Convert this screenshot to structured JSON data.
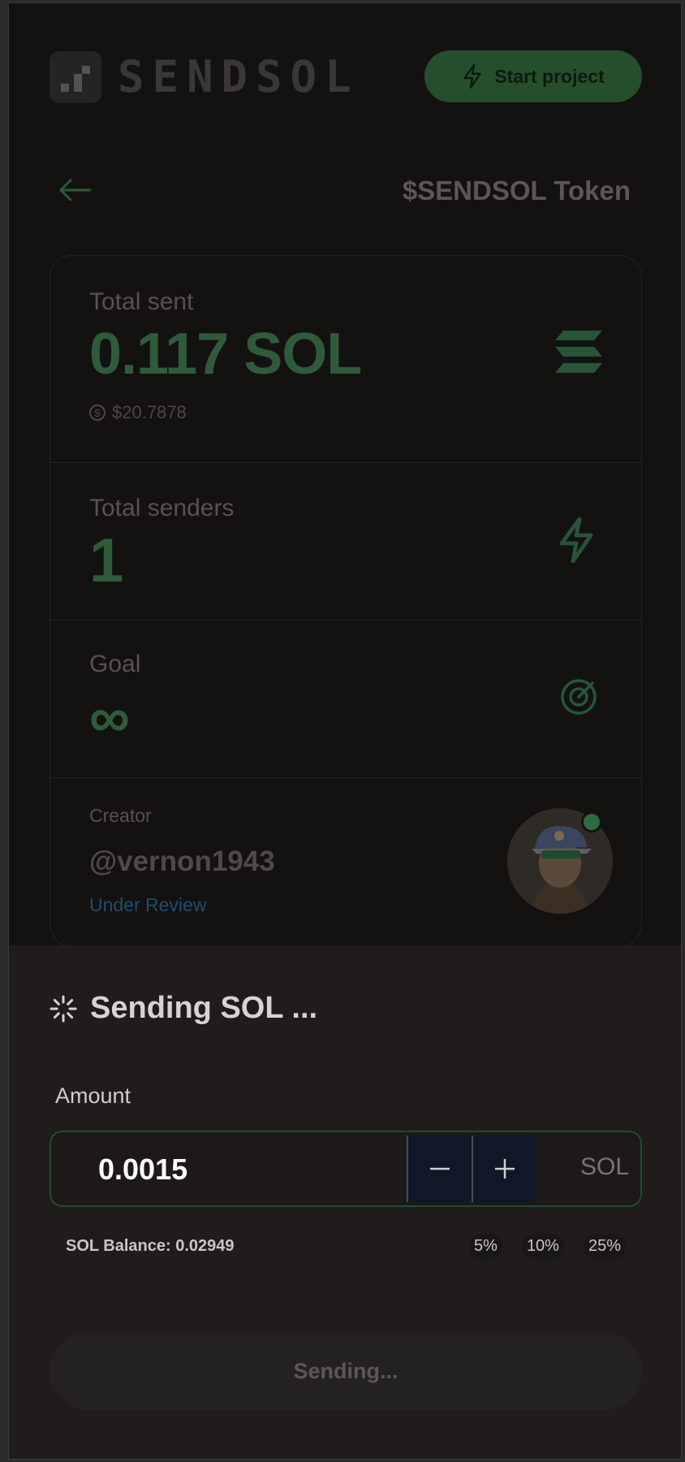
{
  "header": {
    "logo_text": "SENDSOL",
    "start_project_label": "Start project"
  },
  "page": {
    "back_icon": "arrow-left-icon",
    "token_title": "$SENDSOL Token"
  },
  "stats": {
    "total_sent": {
      "label": "Total sent",
      "value": "0.117 SOL",
      "usd": "$20.7878",
      "icon": "solana-icon"
    },
    "total_senders": {
      "label": "Total senders",
      "value": "1",
      "icon": "lightning-icon"
    },
    "goal": {
      "label": "Goal",
      "value": "∞",
      "icon": "target-icon"
    },
    "creator": {
      "label": "Creator",
      "handle": "@vernon1943",
      "status": "Under Review",
      "status_color": "#1d4d6e"
    }
  },
  "sheet": {
    "title": "Sending SOL ...",
    "amount_label": "Amount",
    "amount_value": "0.0015",
    "minus_icon": "minus-icon",
    "plus_icon": "plus-icon",
    "unit": "SOL",
    "balance": "SOL Balance: 0.02949",
    "percent_options": [
      "5%",
      "10%",
      "25%"
    ],
    "submit_label": "Sending..."
  },
  "colors": {
    "accent_green": "#2f5b3a",
    "start_button": "#254f2c",
    "stepper_bg": "#101827"
  }
}
